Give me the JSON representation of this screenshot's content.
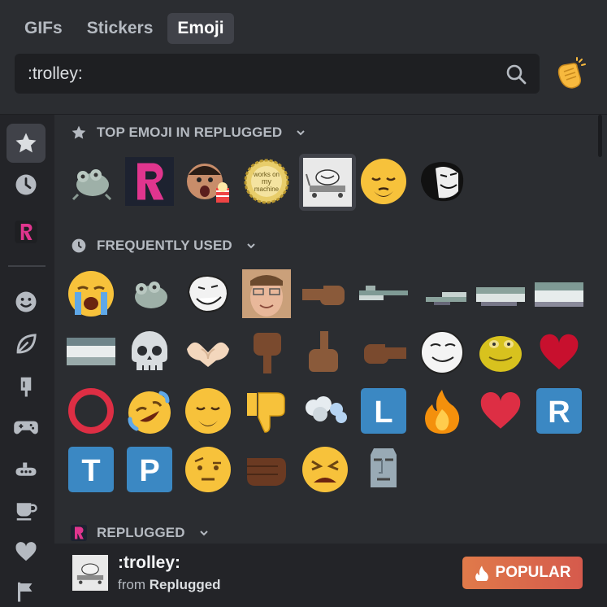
{
  "tabs": [
    {
      "label": "GIFs",
      "active": false
    },
    {
      "label": "Stickers",
      "active": false
    },
    {
      "label": "Emoji",
      "active": true
    }
  ],
  "search": {
    "value": ":trolley:",
    "icon": "search-icon"
  },
  "skin_tone_icon": "clapping-hands-icon",
  "sidebar": {
    "items": [
      "star-icon",
      "clock-icon",
      "replugged-icon",
      "smiley-icon",
      "leaf-icon",
      "popsicle-icon",
      "gamepad-icon",
      "submarine-icon",
      "coffee-icon",
      "heart-icon",
      "flag-icon"
    ]
  },
  "sections": {
    "top": {
      "title": "TOP EMOJI IN REPLUGGED"
    },
    "frequent": {
      "title": "FREQUENTLY USED"
    },
    "replugged": {
      "title": "REPLUGGED"
    }
  },
  "top_emoji": [
    "frog",
    "replugged-logo",
    "pogging-man",
    "works-on-my-machine",
    "trolley",
    "pensive-face-beard",
    "trollface-dark"
  ],
  "frequent_emoji": [
    "loudly-crying-face",
    "frog",
    "trollface",
    "man-photo",
    "pointing-left-brown",
    "glitch-1",
    "glitch-2",
    "glitch-3",
    "glitch-4",
    "glitch-5",
    "skull",
    "heart-hands",
    "pointing-down-brown",
    "pointing-up-brown",
    "pointing-right-brown",
    "smug-trollface",
    "yellow-frog",
    "red-heart",
    "red-ring",
    "rolling-laughing",
    "pensive-face-beard",
    "thumbs-down",
    "dash",
    "letter-L",
    "fire",
    "red-heart",
    "letter-R",
    "letter-T",
    "letter-P",
    "face-raised-eyebrow",
    "fist-brown",
    "tired-face",
    "moai"
  ],
  "letters": {
    "L": "L",
    "R": "R",
    "T": "T",
    "P": "P"
  },
  "footer": {
    "name": ":trolley:",
    "from_prefix": "from",
    "from_source": "Replugged",
    "button": "POPULAR"
  },
  "colors": {
    "accent": "#e07a4a",
    "bg": "#2b2d31",
    "sidebar": "#232428"
  }
}
